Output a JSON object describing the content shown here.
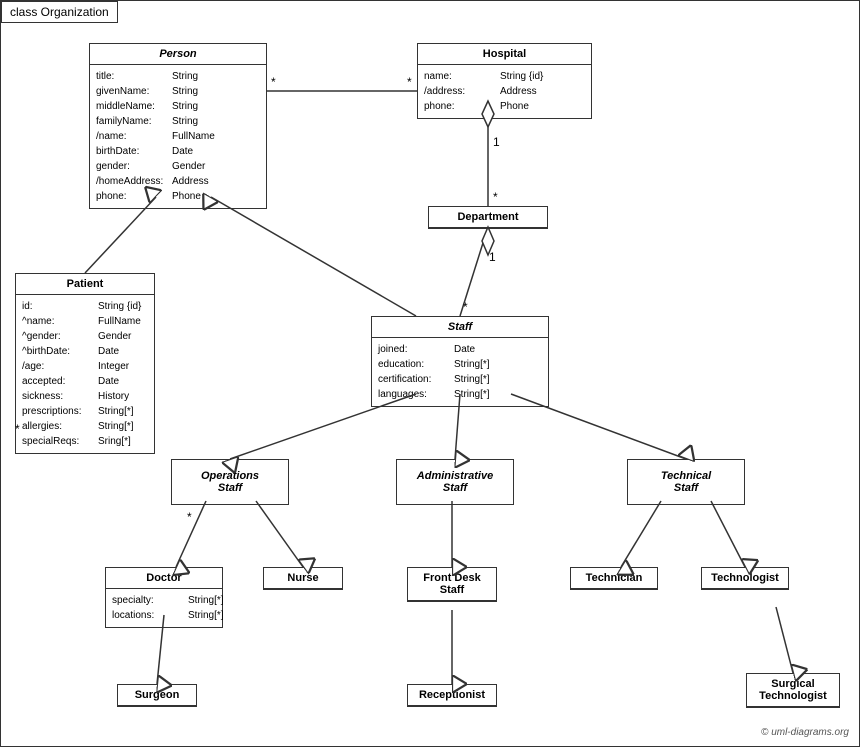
{
  "title": "class Organization",
  "classes": {
    "person": {
      "name": "Person",
      "italic": true,
      "attrs": [
        {
          "name": "title:",
          "type": "String"
        },
        {
          "name": "givenName:",
          "type": "String"
        },
        {
          "name": "middleName:",
          "type": "String"
        },
        {
          "name": "familyName:",
          "type": "String"
        },
        {
          "name": "/name:",
          "type": "FullName"
        },
        {
          "name": "birthDate:",
          "type": "Date"
        },
        {
          "name": "gender:",
          "type": "Gender"
        },
        {
          "name": "/homeAddress:",
          "type": "Address"
        },
        {
          "name": "phone:",
          "type": "Phone"
        }
      ]
    },
    "hospital": {
      "name": "Hospital",
      "italic": false,
      "attrs": [
        {
          "name": "name:",
          "type": "String {id}"
        },
        {
          "name": "/address:",
          "type": "Address"
        },
        {
          "name": "phone:",
          "type": "Phone"
        }
      ]
    },
    "department": {
      "name": "Department",
      "italic": false,
      "attrs": []
    },
    "staff": {
      "name": "Staff",
      "italic": true,
      "attrs": [
        {
          "name": "joined:",
          "type": "Date"
        },
        {
          "name": "education:",
          "type": "String[*]"
        },
        {
          "name": "certification:",
          "type": "String[*]"
        },
        {
          "name": "languages:",
          "type": "String[*]"
        }
      ]
    },
    "patient": {
      "name": "Patient",
      "italic": false,
      "attrs": [
        {
          "name": "id:",
          "type": "String {id}"
        },
        {
          "name": "^name:",
          "type": "FullName"
        },
        {
          "name": "^gender:",
          "type": "Gender"
        },
        {
          "name": "^birthDate:",
          "type": "Date"
        },
        {
          "name": "/age:",
          "type": "Integer"
        },
        {
          "name": "accepted:",
          "type": "Date"
        },
        {
          "name": "sickness:",
          "type": "History"
        },
        {
          "name": "prescriptions:",
          "type": "String[*]"
        },
        {
          "name": "allergies:",
          "type": "String[*]"
        },
        {
          "name": "specialReqs:",
          "type": "Sring[*]"
        }
      ]
    },
    "operations_staff": {
      "name": "Operations Staff",
      "italic": true
    },
    "administrative_staff": {
      "name": "Administrative Staff",
      "italic": true
    },
    "technical_staff": {
      "name": "Technical Staff",
      "italic": true
    },
    "doctor": {
      "name": "Doctor",
      "italic": false,
      "attrs": [
        {
          "name": "specialty:",
          "type": "String[*]"
        },
        {
          "name": "locations:",
          "type": "String[*]"
        }
      ]
    },
    "nurse": {
      "name": "Nurse",
      "italic": false,
      "attrs": []
    },
    "front_desk_staff": {
      "name": "Front Desk Staff",
      "italic": false,
      "attrs": []
    },
    "technician": {
      "name": "Technician",
      "italic": false,
      "attrs": []
    },
    "technologist": {
      "name": "Technologist",
      "italic": false,
      "attrs": []
    },
    "surgeon": {
      "name": "Surgeon",
      "italic": false,
      "attrs": []
    },
    "receptionist": {
      "name": "Receptionist",
      "italic": false,
      "attrs": []
    },
    "surgical_technologist": {
      "name": "Surgical Technologist",
      "italic": false,
      "attrs": []
    }
  },
  "copyright": "© uml-diagrams.org"
}
